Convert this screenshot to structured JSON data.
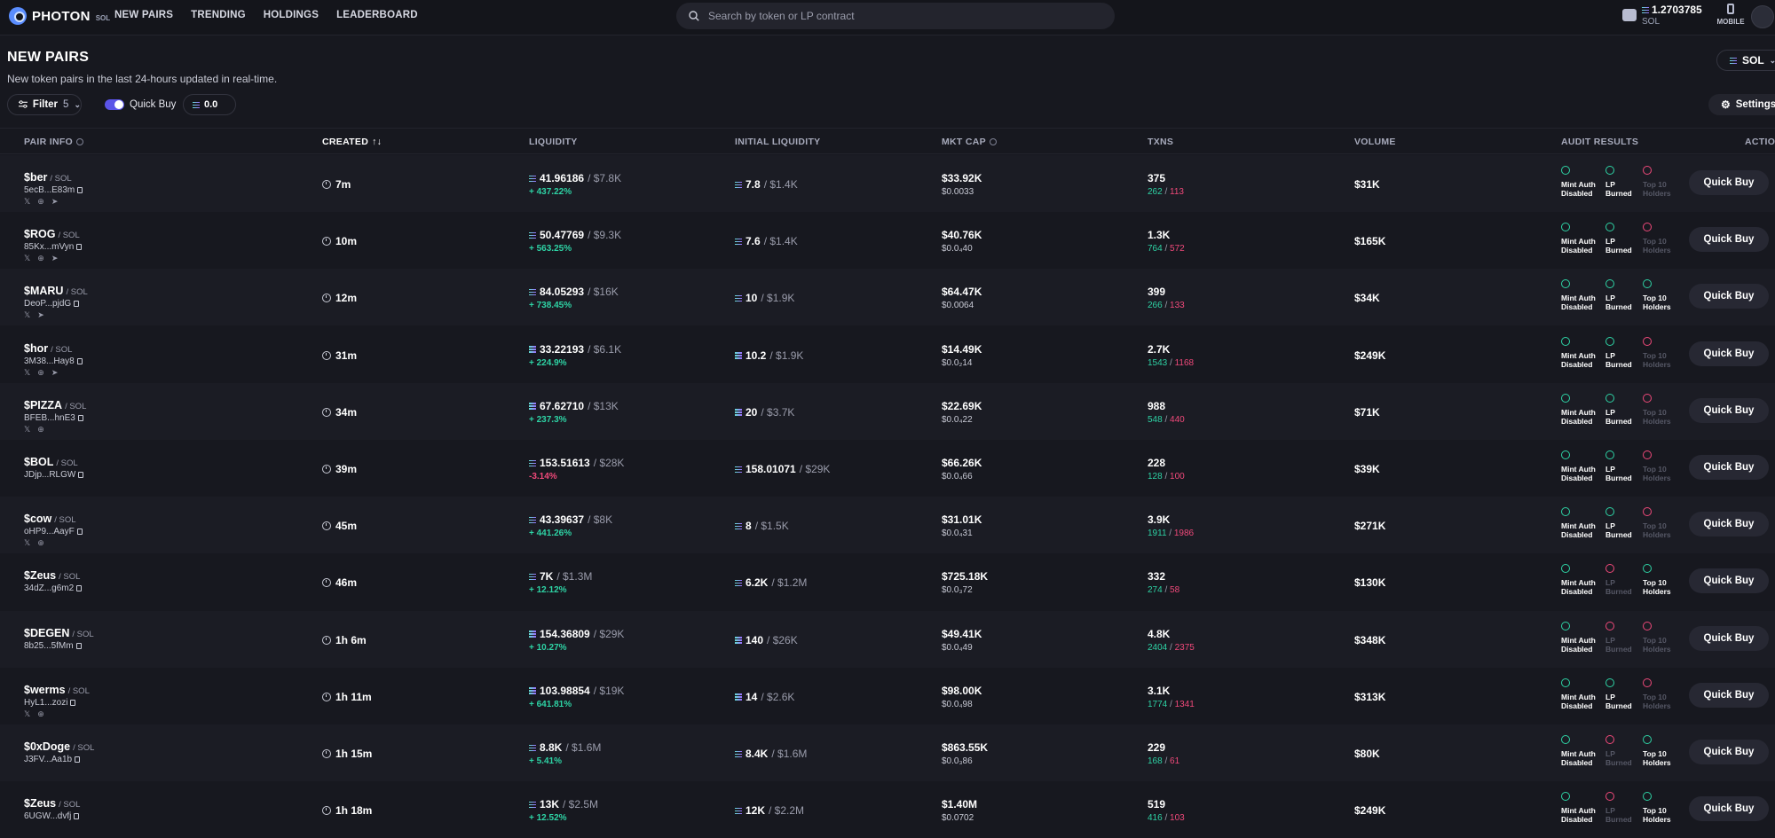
{
  "nav": {
    "logo_text": "PHOTON",
    "logo_sub": "SOL",
    "links": [
      "NEW PAIRS",
      "TRENDING",
      "HOLDINGS",
      "LEADERBOARD"
    ],
    "search_placeholder": "Search by token or LP contract",
    "wallet_balance": "1.2703785",
    "wallet_unit": "SOL",
    "mobile_label": "MOBILE"
  },
  "header": {
    "title": "NEW PAIRS",
    "subtitle": "New token pairs in the last 24-hours updated in real-time.",
    "chain_select": "SOL",
    "filter_label": "Filter",
    "filter_count": "5",
    "quick_buy_label": "Quick Buy",
    "quick_buy_amount": "0.0",
    "settings_label": "Settings"
  },
  "columns": [
    "PAIR INFO",
    "CREATED",
    "LIQUIDITY",
    "INITIAL LIQUIDITY",
    "MKT CAP",
    "TXNS",
    "VOLUME",
    "AUDIT RESULTS",
    "ACTION"
  ],
  "created_sort_icon": "↑↓",
  "audit_labels": {
    "mint": [
      "Mint Auth",
      "Disabled"
    ],
    "lp": [
      "LP",
      "Burned"
    ],
    "top10": [
      "Top 10",
      "Holders"
    ]
  },
  "quick_buy_button": "Quick Buy",
  "rows": [
    {
      "name": "$ber",
      "quote": "/ SOL",
      "addr": "5ecB...E83m",
      "socials": [
        "𝕏",
        "⊕",
        "➤"
      ],
      "created": "7m",
      "liq": "41.96186",
      "liq_usd": "/ $7.8K",
      "liq_pct": "+ 437.22%",
      "liq_dir": "up",
      "init": "7.8",
      "init_usd": "/ $1.4K",
      "mcap": "$33.92K",
      "price": "$0.0033",
      "tx": "375",
      "buys": "262",
      "sells": "113",
      "vol": "$31K",
      "audit": [
        true,
        true,
        false
      ]
    },
    {
      "name": "$ROG",
      "quote": "/ SOL",
      "addr": "85Kx...mVyn",
      "socials": [
        "𝕏",
        "⊕",
        "➤"
      ],
      "created": "10m",
      "liq": "50.47769",
      "liq_usd": "/ $9.3K",
      "liq_pct": "+ 563.25%",
      "liq_dir": "up",
      "init": "7.6",
      "init_usd": "/ $1.4K",
      "mcap": "$40.76K",
      "price": "$0.0₄40",
      "tx": "1.3K",
      "buys": "764",
      "sells": "572",
      "vol": "$165K",
      "audit": [
        true,
        true,
        false
      ]
    },
    {
      "name": "$MARU",
      "quote": "/ SOL",
      "addr": "DeoP...pjdG",
      "socials": [
        "𝕏",
        "➤"
      ],
      "created": "12m",
      "liq": "84.05293",
      "liq_usd": "/ $16K",
      "liq_pct": "+ 738.45%",
      "liq_dir": "up",
      "init": "10",
      "init_usd": "/ $1.9K",
      "mcap": "$64.47K",
      "price": "$0.0064",
      "tx": "399",
      "buys": "266",
      "sells": "133",
      "vol": "$34K",
      "audit": [
        true,
        true,
        true
      ]
    },
    {
      "name": "$hor",
      "quote": "/ SOL",
      "addr": "3M38...Hay8",
      "socials": [
        "𝕏",
        "⊕",
        "➤"
      ],
      "created": "31m",
      "liq": "33.22193",
      "liq_usd": "/ $6.1K",
      "liq_pct": "+ 224.9%",
      "liq_dir": "up",
      "init": "10.2",
      "init_usd": "/ $1.9K",
      "mcap": "$14.49K",
      "price": "$0.0₂14",
      "tx": "2.7K",
      "buys": "1543",
      "sells": "1168",
      "vol": "$249K",
      "audit": [
        true,
        true,
        false
      ]
    },
    {
      "name": "$PIZZA",
      "quote": "/ SOL",
      "addr": "BFEB...hnE3",
      "socials": [
        "𝕏",
        "⊕"
      ],
      "created": "34m",
      "liq": "67.62710",
      "liq_usd": "/ $13K",
      "liq_pct": "+ 237.3%",
      "liq_dir": "up",
      "init": "20",
      "init_usd": "/ $3.7K",
      "mcap": "$22.69K",
      "price": "$0.0₄22",
      "tx": "988",
      "buys": "548",
      "sells": "440",
      "vol": "$71K",
      "audit": [
        true,
        true,
        false
      ]
    },
    {
      "name": "$BOL",
      "quote": "/ SOL",
      "addr": "JDjp...RLGW",
      "socials": [],
      "created": "39m",
      "liq": "153.51613",
      "liq_usd": "/ $28K",
      "liq_pct": "-3.14%",
      "liq_dir": "down",
      "init": "158.01071",
      "init_usd": "/ $29K",
      "mcap": "$66.26K",
      "price": "$0.0₄66",
      "tx": "228",
      "buys": "128",
      "sells": "100",
      "vol": "$39K",
      "audit": [
        true,
        true,
        false
      ]
    },
    {
      "name": "$cow",
      "quote": "/ SOL",
      "addr": "oHP9...AayF",
      "socials": [
        "𝕏",
        "⊕"
      ],
      "created": "45m",
      "liq": "43.39637",
      "liq_usd": "/ $8K",
      "liq_pct": "+ 441.26%",
      "liq_dir": "up",
      "init": "8",
      "init_usd": "/ $1.5K",
      "mcap": "$31.01K",
      "price": "$0.0₄31",
      "tx": "3.9K",
      "buys": "1911",
      "sells": "1986",
      "vol": "$271K",
      "audit": [
        true,
        true,
        false
      ]
    },
    {
      "name": "$Zeus",
      "quote": "/ SOL",
      "addr": "34dZ...g6m2",
      "socials": [],
      "created": "46m",
      "liq": "7K",
      "liq_usd": "/ $1.3M",
      "liq_pct": "+ 12.12%",
      "liq_dir": "up",
      "init": "6.2K",
      "init_usd": "/ $1.2M",
      "mcap": "$725.18K",
      "price": "$0.0₃72",
      "tx": "332",
      "buys": "274",
      "sells": "58",
      "vol": "$130K",
      "audit": [
        true,
        false,
        true
      ]
    },
    {
      "name": "$DEGEN",
      "quote": "/ SOL",
      "addr": "8b25...5fMm",
      "socials": [],
      "created": "1h 6m",
      "liq": "154.36809",
      "liq_usd": "/ $29K",
      "liq_pct": "+ 10.27%",
      "liq_dir": "up",
      "init": "140",
      "init_usd": "/ $26K",
      "mcap": "$49.41K",
      "price": "$0.0₄49",
      "tx": "4.8K",
      "buys": "2404",
      "sells": "2375",
      "vol": "$348K",
      "audit": [
        true,
        false,
        false
      ]
    },
    {
      "name": "$werms",
      "quote": "/ SOL",
      "addr": "HyL1...zozi",
      "socials": [
        "𝕏",
        "⊕"
      ],
      "created": "1h 11m",
      "liq": "103.98854",
      "liq_usd": "/ $19K",
      "liq_pct": "+ 641.81%",
      "liq_dir": "up",
      "init": "14",
      "init_usd": "/ $2.6K",
      "mcap": "$98.00K",
      "price": "$0.0₄98",
      "tx": "3.1K",
      "buys": "1774",
      "sells": "1341",
      "vol": "$313K",
      "audit": [
        true,
        true,
        false
      ]
    },
    {
      "name": "$0xDoge",
      "quote": "/ SOL",
      "addr": "J3FV...Aa1b",
      "socials": [],
      "created": "1h 15m",
      "liq": "8.8K",
      "liq_usd": "/ $1.6M",
      "liq_pct": "+ 5.41%",
      "liq_dir": "up",
      "init": "8.4K",
      "init_usd": "/ $1.6M",
      "mcap": "$863.55K",
      "price": "$0.0₃86",
      "tx": "229",
      "buys": "168",
      "sells": "61",
      "vol": "$80K",
      "audit": [
        true,
        false,
        true
      ]
    },
    {
      "name": "$Zeus",
      "quote": "/ SOL",
      "addr": "6UGW...dvfj",
      "socials": [],
      "created": "1h 18m",
      "liq": "13K",
      "liq_usd": "/ $2.5M",
      "liq_pct": "+ 12.52%",
      "liq_dir": "up",
      "init": "12K",
      "init_usd": "/ $2.2M",
      "mcap": "$1.40M",
      "price": "$0.0702",
      "tx": "519",
      "buys": "416",
      "sells": "103",
      "vol": "$249K",
      "audit": [
        true,
        false,
        true
      ]
    }
  ]
}
